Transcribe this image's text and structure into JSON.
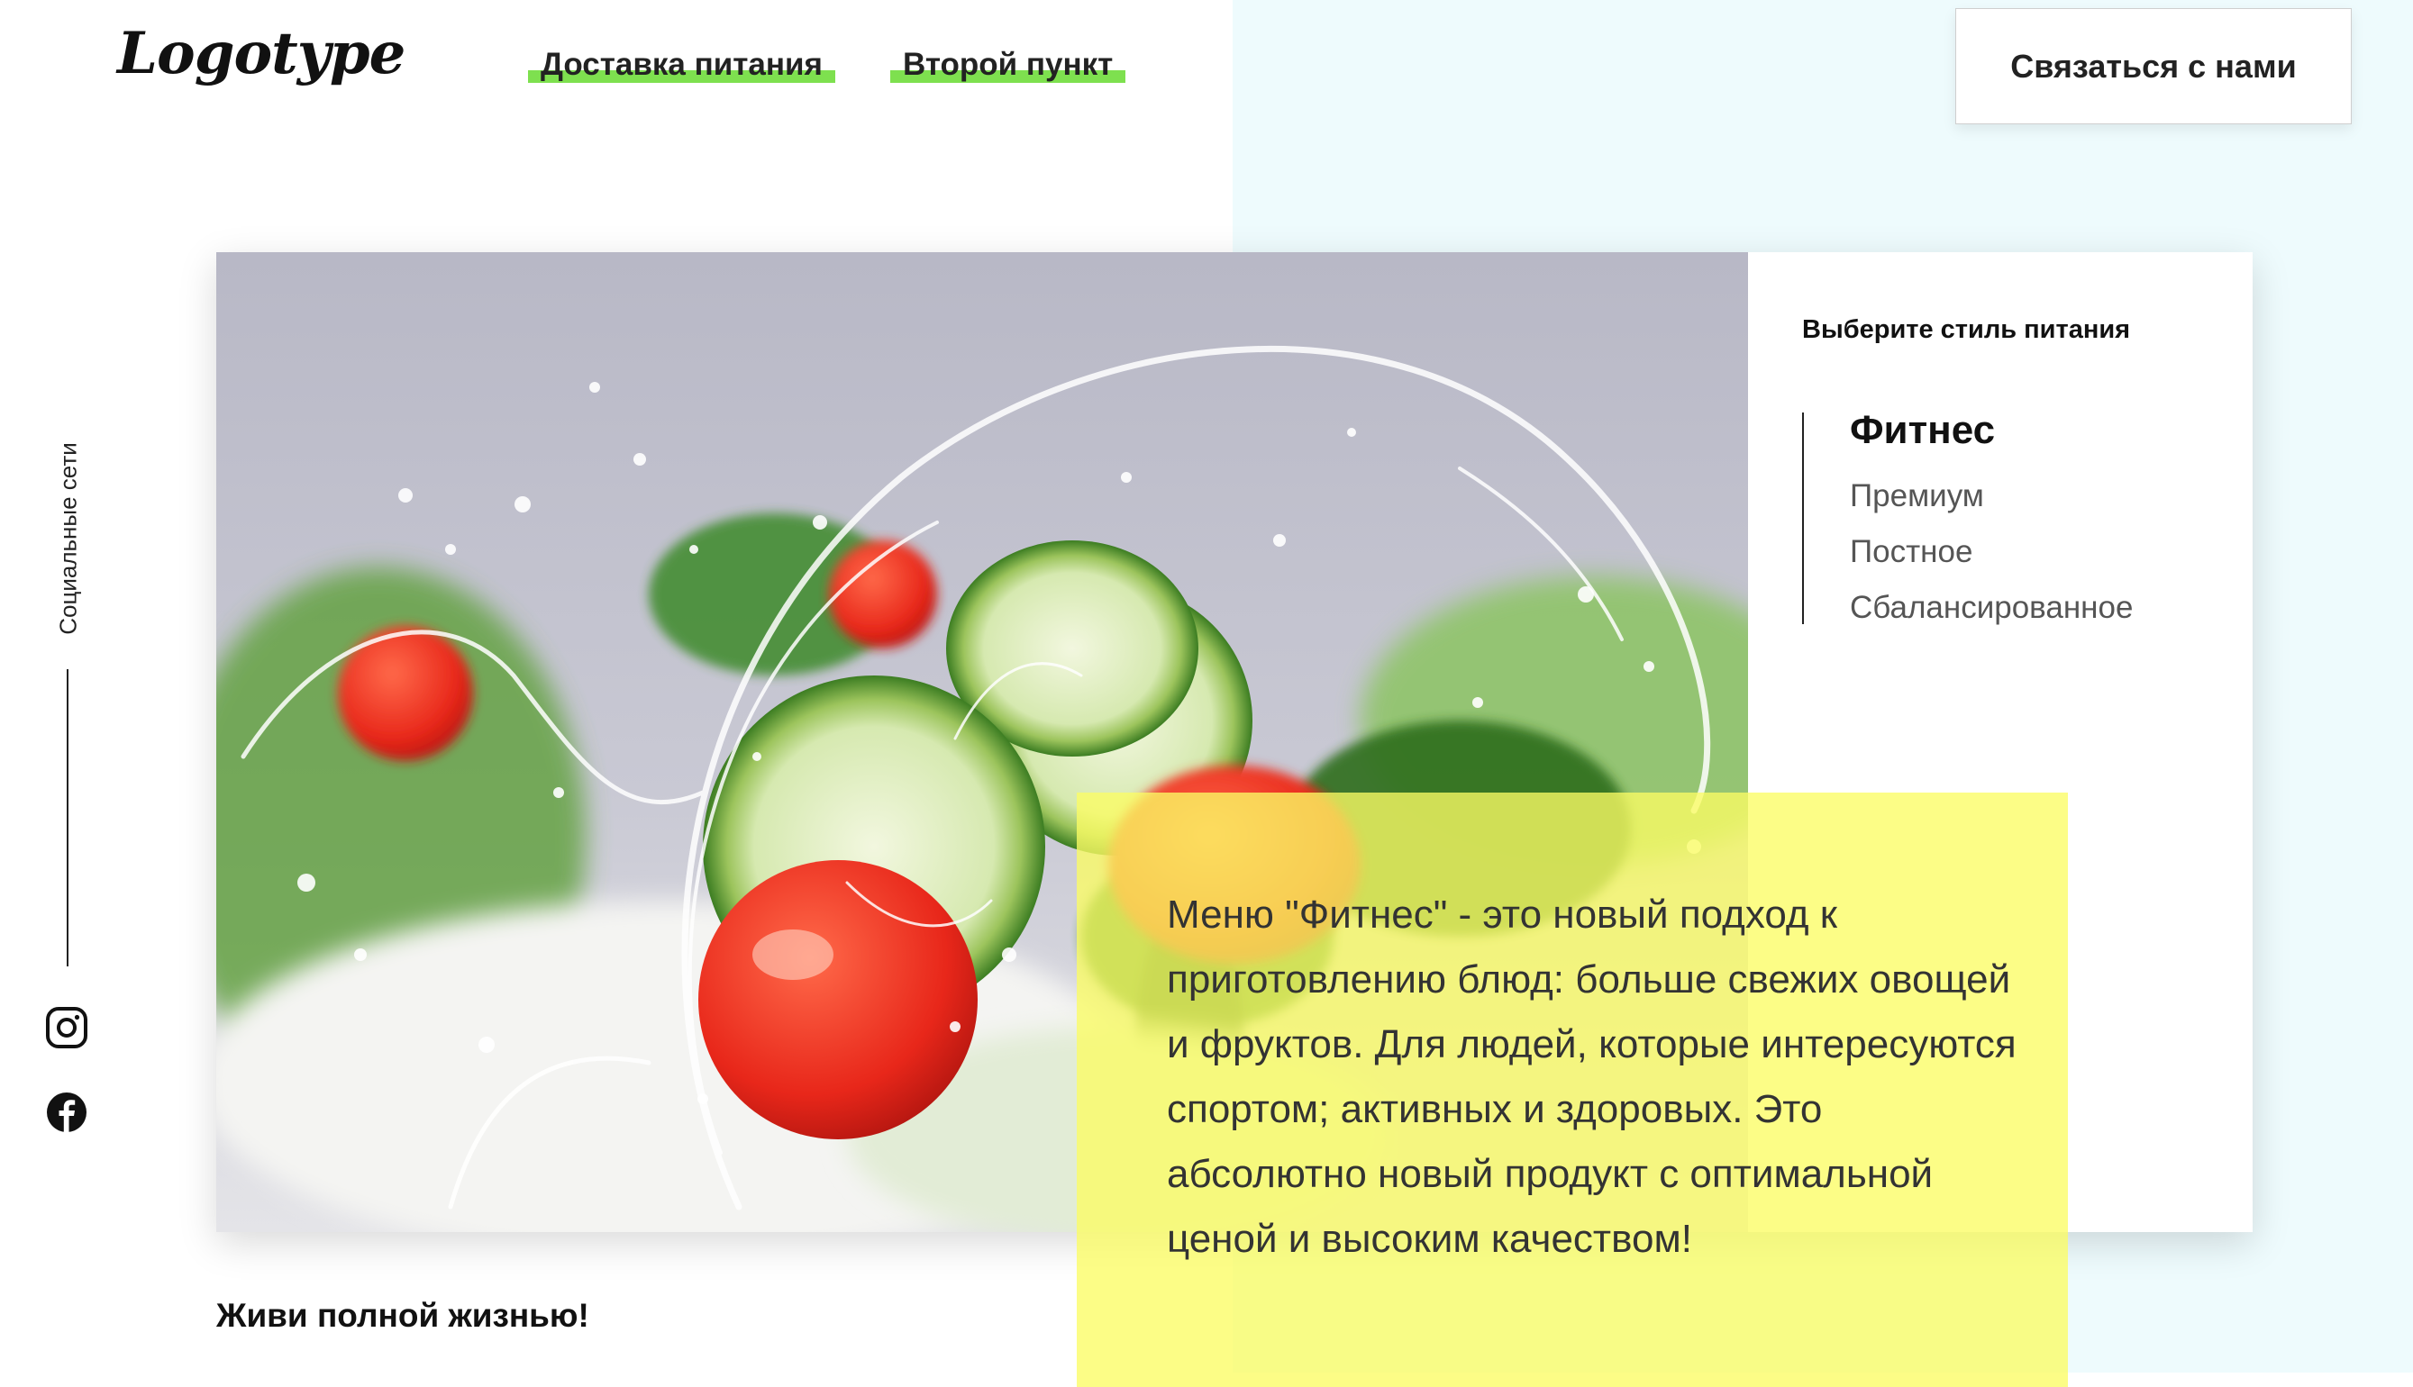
{
  "header": {
    "logo": "Logotype",
    "nav": [
      "Доставка питания",
      "Второй пункт"
    ],
    "contact_button": "Связаться с нами"
  },
  "social": {
    "label": "Социальные сети",
    "icons": [
      "instagram-icon",
      "facebook-icon"
    ]
  },
  "menu_panel": {
    "title": "Выберите стиль питания",
    "items": [
      "Фитнес",
      "Премиум",
      "Постное",
      "Сбалансированное"
    ],
    "active_item": "Фитнес"
  },
  "description": "Меню \"Фитнес\" - это новый подход к приготовлению блюд: больше свежих овощей и фруктов. Для людей, которые интересуются спортом; активных и здоровых. Это абсолютно новый продукт с оптимальной ценой и высоким качеством!",
  "tagline": "Живи полной жизнью!",
  "colors": {
    "accent_green": "#7ee04f",
    "highlight_yellow": "#fbfd64",
    "right_background": "#eefbfd"
  }
}
